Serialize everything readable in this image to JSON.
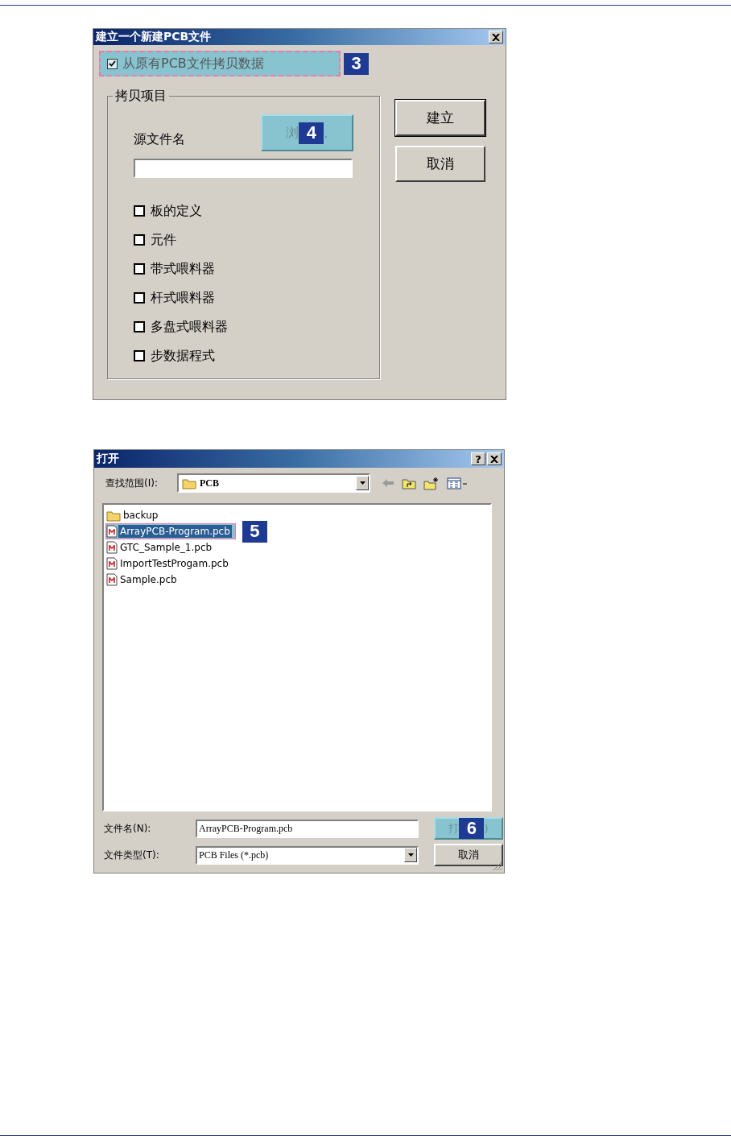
{
  "new_pcb_dialog": {
    "title": "建立一个新建PCB文件",
    "copy_option": {
      "label": "从原有PCB文件拷贝数据",
      "checked": true,
      "callout": "3"
    },
    "group": {
      "legend": "拷贝项目",
      "source_label": "源文件名",
      "browse_button": {
        "label_start": "浏",
        "label_end": ".",
        "callout": "4"
      },
      "items": [
        {
          "label": "板的定义",
          "checked": false
        },
        {
          "label": "元件",
          "checked": false
        },
        {
          "label": "带式喂料器",
          "checked": false
        },
        {
          "label": "杆式喂料器",
          "checked": false
        },
        {
          "label": "多盘式喂料器",
          "checked": false
        },
        {
          "label": "步数据程式",
          "checked": false
        }
      ]
    },
    "buttons": [
      "建立",
      "取消"
    ]
  },
  "open_dialog": {
    "title": "打开",
    "help_button": "?",
    "look_in": {
      "label": "查找范围(I):",
      "value": "PCB"
    },
    "files": [
      {
        "name": "backup",
        "kind": "folder",
        "selected": false
      },
      {
        "name": "ArrayPCB-Program.pcb",
        "kind": "pcb",
        "selected": true,
        "callout": "5"
      },
      {
        "name": "GTC_Sample_1.pcb",
        "kind": "pcb",
        "selected": false
      },
      {
        "name": "ImportTestProgam.pcb",
        "kind": "pcb",
        "selected": false
      },
      {
        "name": "Sample.pcb",
        "kind": "pcb",
        "selected": false
      }
    ],
    "file_name": {
      "label": "文件名(N):",
      "value": "ArrayPCB-Program.pcb"
    },
    "file_type": {
      "label": "文件类型(T):",
      "value": "PCB Files (*.pcb)"
    },
    "open_button": {
      "label_start": "打",
      "label_end": ")",
      "callout": "6"
    },
    "cancel_button": "取消"
  }
}
